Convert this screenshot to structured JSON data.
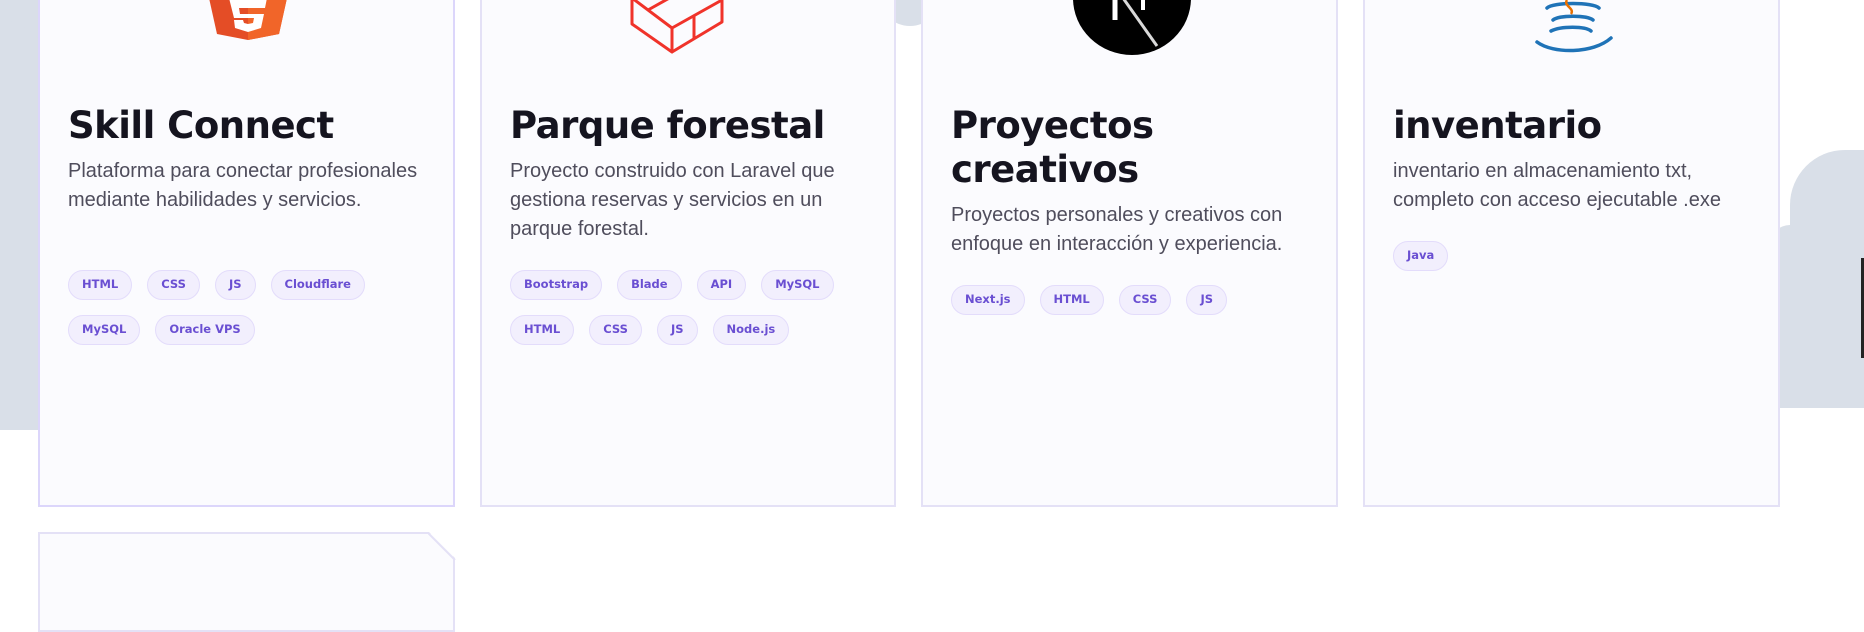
{
  "projects": [
    {
      "title": "Skill Connect",
      "description": "Plataforma para conectar profesionales mediante habilidades y servicios.",
      "icon": "html5-icon",
      "tags": [
        "HTML",
        "CSS",
        "JS",
        "Cloudflare",
        "MySQL",
        "Oracle VPS"
      ]
    },
    {
      "title": "Parque forestal",
      "description": "Proyecto construido con Laravel que gestiona reservas y servicios en un parque forestal.",
      "icon": "laravel-icon",
      "tags": [
        "Bootstrap",
        "Blade",
        "API",
        "MySQL",
        "HTML",
        "CSS",
        "JS",
        "Node.js"
      ]
    },
    {
      "title": "Proyectos creativos",
      "description": "Proyectos personales y creativos con enfoque en interacción y experiencia.",
      "icon": "nextjs-icon",
      "tags": [
        "Next.js",
        "HTML",
        "CSS",
        "JS"
      ]
    },
    {
      "title": "inventario",
      "description": "inventario en almacenamiento txt, completo con acceso ejecutable .exe",
      "icon": "java-icon",
      "tags": [
        "Java"
      ]
    }
  ],
  "colors": {
    "tag_text": "#6a4fd2",
    "tag_bg": "#f2effd",
    "title": "#15141f",
    "html5_orange": "#e44d26",
    "laravel_red": "#f0332a",
    "java_blue": "#1f73b7"
  }
}
